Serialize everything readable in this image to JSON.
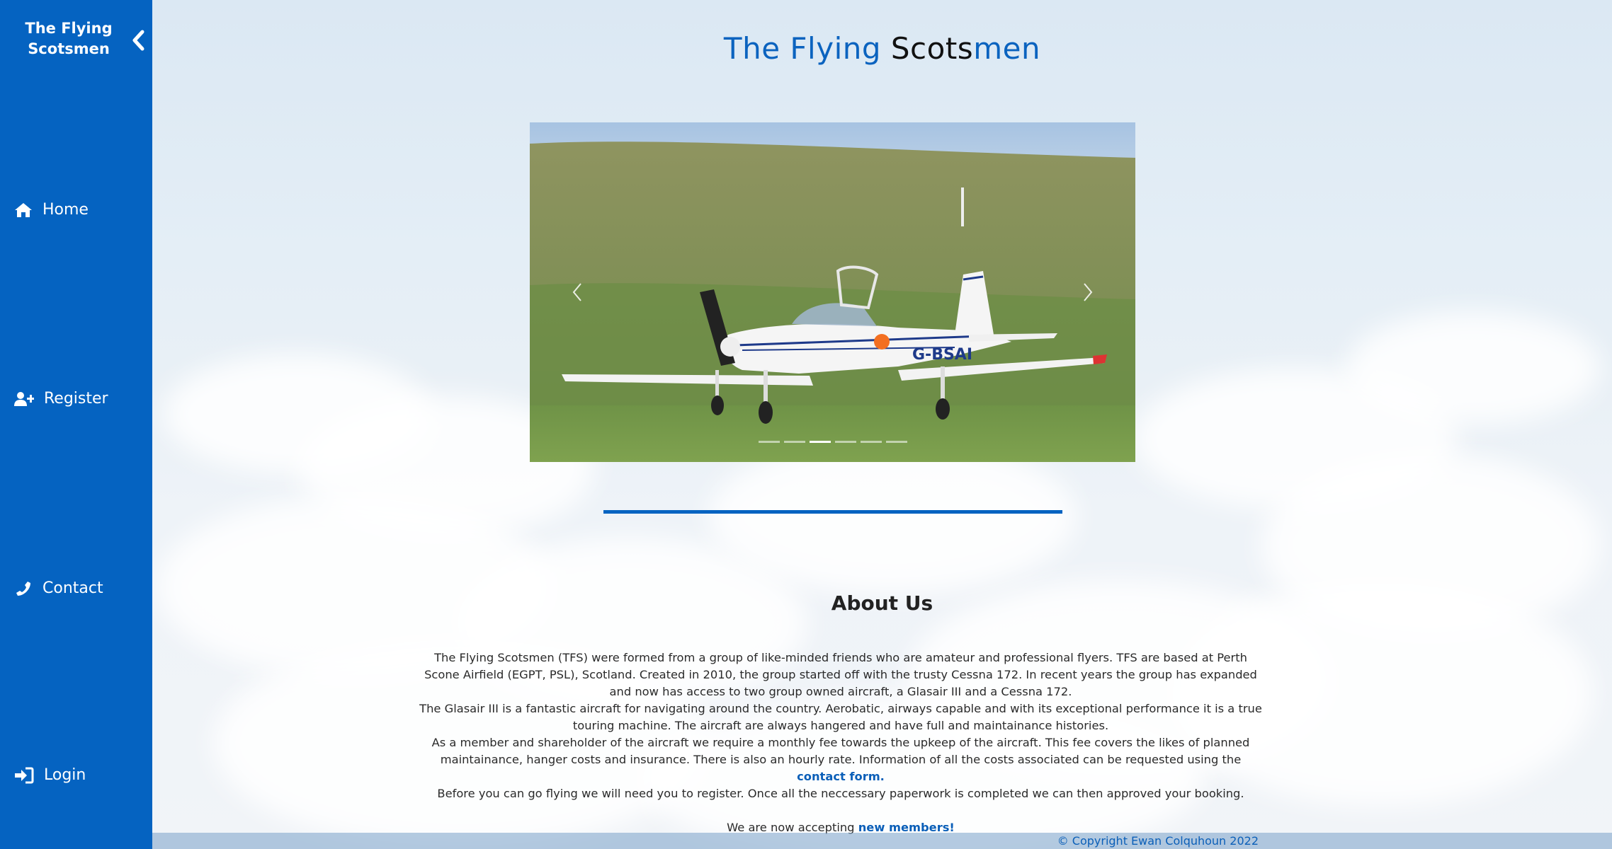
{
  "sidebar": {
    "brand_line1": "The Flying",
    "brand_line2": "Scotsmen",
    "items": [
      {
        "label": "Home",
        "icon": "home-icon"
      },
      {
        "label": "Register",
        "icon": "user-plus-icon"
      },
      {
        "label": "Contact",
        "icon": "phone-icon"
      },
      {
        "label": "Login",
        "icon": "sign-in-icon"
      }
    ]
  },
  "header": {
    "title_part1": "The Flying ",
    "title_part2": "Scots",
    "title_part3": "men"
  },
  "carousel": {
    "aircraft_registration": "G-BSAI",
    "slide_count": 6,
    "active_slide": 3
  },
  "about": {
    "title": "About Us",
    "p1": "The Flying Scotsmen (TFS) were formed from a group of like-minded friends who are amateur and professional flyers. TFS are based at Perth Scone Airfield (EGPT, PSL), Scotland. Created in 2010, the group started off with the trusty Cessna 172. In recent years the group has expanded and now has access to two group owned aircraft, a Glasair III and a Cessna 172.",
    "p2": "The Glasair III is a fantastic aircraft for navigating around the country. Aerobatic, airways capable and with its exceptional performance it is a true touring machine. The aircraft are always hangered and have full and maintainance histories.",
    "p3": "As a member and shareholder of the aircraft we require a monthly fee towards the upkeep of the aircraft. This fee covers the likes of planned maintainance, hanger costs and insurance. There is also an hourly rate. Information of all the costs associated can be requested using the ",
    "p3_link": "contact form.",
    "p4": "Before you can go flying we will need you to register. Once all the neccessary paperwork is completed we can then approved your booking.",
    "p5": "We are now accepting ",
    "p5_link": "new members!"
  },
  "footer": {
    "copyright": "© Copyright Ewan Colquhoun 2022"
  },
  "colors": {
    "brand_blue": "#0563c1",
    "title_blue": "#0b63bf"
  }
}
